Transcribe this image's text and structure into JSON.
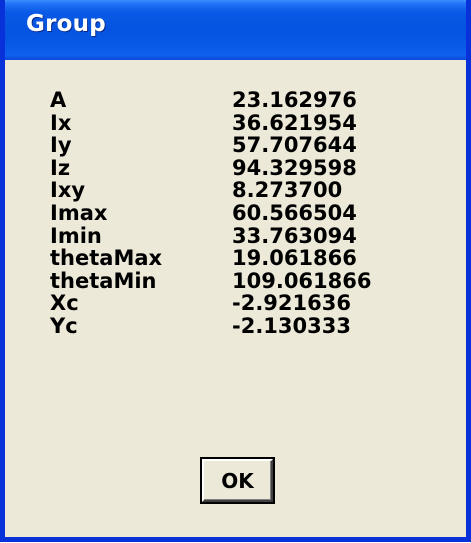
{
  "window": {
    "title": "Group"
  },
  "properties": [
    {
      "label": "A",
      "value": "23.162976"
    },
    {
      "label": "Ix",
      "value": "36.621954"
    },
    {
      "label": "Iy",
      "value": "57.707644"
    },
    {
      "label": "Iz",
      "value": "94.329598"
    },
    {
      "label": "Ixy",
      "value": "8.273700"
    },
    {
      "label": "Imax",
      "value": "60.566504"
    },
    {
      "label": "Imin",
      "value": "33.763094"
    },
    {
      "label": "thetaMax",
      "value": "19.061866"
    },
    {
      "label": "thetaMin",
      "value": "109.061866"
    },
    {
      "label": "Xc",
      "value": "-2.921636"
    },
    {
      "label": "Yc",
      "value": "-2.130333"
    }
  ],
  "buttons": {
    "ok_label": "OK"
  },
  "colors": {
    "titlebar": "#0553e0",
    "dialog_background": "#ece9d8",
    "frame": "#0831d9",
    "title_text": "#ffffff"
  }
}
